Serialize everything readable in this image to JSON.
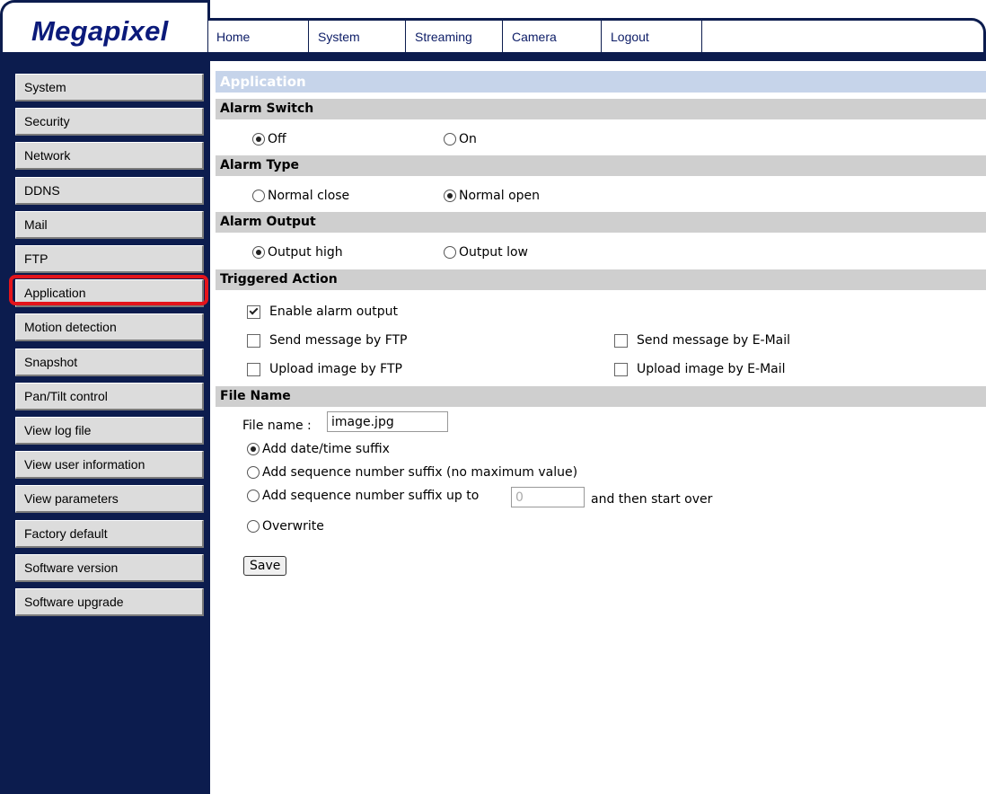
{
  "brand": {
    "logo": "Megapixel"
  },
  "topnav": [
    {
      "label": "Home"
    },
    {
      "label": "System"
    },
    {
      "label": "Streaming"
    },
    {
      "label": "Camera"
    },
    {
      "label": "Logout"
    }
  ],
  "sidebar": {
    "items": [
      {
        "label": "System"
      },
      {
        "label": "Security"
      },
      {
        "label": "Network"
      },
      {
        "label": "DDNS"
      },
      {
        "label": "Mail"
      },
      {
        "label": "FTP"
      },
      {
        "label": "Application"
      },
      {
        "label": "Motion detection"
      },
      {
        "label": "Snapshot"
      },
      {
        "label": "Pan/Tilt control"
      },
      {
        "label": "View log file"
      },
      {
        "label": "View user information"
      },
      {
        "label": "View parameters"
      },
      {
        "label": "Factory default"
      },
      {
        "label": "Software version"
      },
      {
        "label": "Software upgrade"
      }
    ],
    "selected": "Application",
    "highlight_color": "#e4141b"
  },
  "colors": {
    "navy": "#0c1c4e",
    "section_header": "#cfcfcf",
    "title_bar": "#c6d4ea"
  },
  "main": {
    "title": "Application",
    "alarm_switch": {
      "header": "Alarm Switch",
      "off": "Off",
      "on": "On",
      "selected": "Off"
    },
    "alarm_type": {
      "header": "Alarm Type",
      "normal_close": "Normal close",
      "normal_open": "Normal open",
      "selected": "Normal open"
    },
    "alarm_output": {
      "header": "Alarm Output",
      "high": "Output high",
      "low": "Output low",
      "selected": "Output high"
    },
    "triggered_action": {
      "header": "Triggered Action",
      "enable_alarm_output": {
        "label": "Enable alarm output",
        "checked": true
      },
      "send_ftp": {
        "label": "Send message by FTP",
        "checked": false
      },
      "send_email": {
        "label": "Send message by E-Mail",
        "checked": false
      },
      "upload_ftp": {
        "label": "Upload image by FTP",
        "checked": false
      },
      "upload_email": {
        "label": "Upload image by E-Mail",
        "checked": false
      }
    },
    "file_name": {
      "header": "File Name",
      "label": "File name :",
      "value": "image.jpg",
      "date_suffix": "Add date/time suffix",
      "seq_suffix": "Add sequence number suffix (no maximum value)",
      "seq_upto": "Add sequence number suffix up to",
      "seq_upto_value": "0",
      "then_start_over": "and then start over",
      "overwrite": "Overwrite",
      "selected": "Add date/time suffix"
    },
    "save_label": "Save"
  }
}
